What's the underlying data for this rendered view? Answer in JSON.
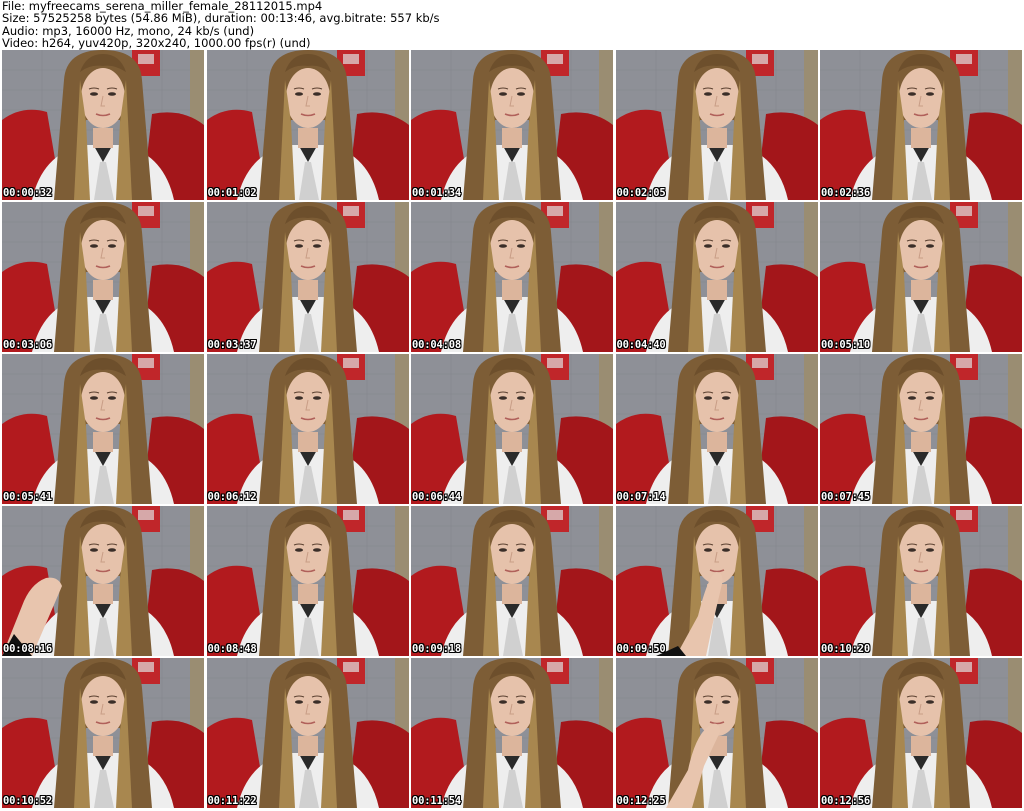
{
  "header": {
    "file_line": "File: myfreecams_serena_miller_female_28112015.mp4",
    "size_line": "Size: 57525258 bytes (54.86 MiB), duration: 00:13:46, avg.bitrate: 557 kb/s",
    "audio_line": "Audio: mp3, 16000 Hz, mono, 24 kb/s (und)",
    "video_line": "Video: h264, yuv420p, 320x240, 1000.00 fps(r) (und)"
  },
  "colors": {
    "curtain_red": "#b21a1e",
    "wall_gray": "#8c8f96",
    "shirt_white": "#eeeeee",
    "hair_brown": "#8a6a40",
    "skin": "#e6c2ab",
    "timestamp_text": "#ffffff"
  },
  "thumbnails": [
    {
      "time": "00:00:32",
      "pose": "normal"
    },
    {
      "time": "00:01:02",
      "pose": "normal"
    },
    {
      "time": "00:01:34",
      "pose": "normal"
    },
    {
      "time": "00:02:05",
      "pose": "normal"
    },
    {
      "time": "00:02:36",
      "pose": "normal"
    },
    {
      "time": "00:03:06",
      "pose": "normal"
    },
    {
      "time": "00:03:37",
      "pose": "normal"
    },
    {
      "time": "00:04:08",
      "pose": "normal"
    },
    {
      "time": "00:04:40",
      "pose": "normal"
    },
    {
      "time": "00:05:10",
      "pose": "normal"
    },
    {
      "time": "00:05:41",
      "pose": "normal"
    },
    {
      "time": "00:06:12",
      "pose": "normal"
    },
    {
      "time": "00:06:44",
      "pose": "normal"
    },
    {
      "time": "00:07:14",
      "pose": "normal"
    },
    {
      "time": "00:07:45",
      "pose": "normal"
    },
    {
      "time": "00:08:16",
      "pose": "hand-left"
    },
    {
      "time": "00:08:48",
      "pose": "normal"
    },
    {
      "time": "00:09:18",
      "pose": "normal"
    },
    {
      "time": "00:09:50",
      "pose": "hand-chin"
    },
    {
      "time": "00:10:20",
      "pose": "normal"
    },
    {
      "time": "00:10:52",
      "pose": "normal"
    },
    {
      "time": "00:11:22",
      "pose": "normal"
    },
    {
      "time": "00:11:54",
      "pose": "normal"
    },
    {
      "time": "00:12:25",
      "pose": "hand-mouth"
    },
    {
      "time": "00:12:56",
      "pose": "normal"
    }
  ]
}
